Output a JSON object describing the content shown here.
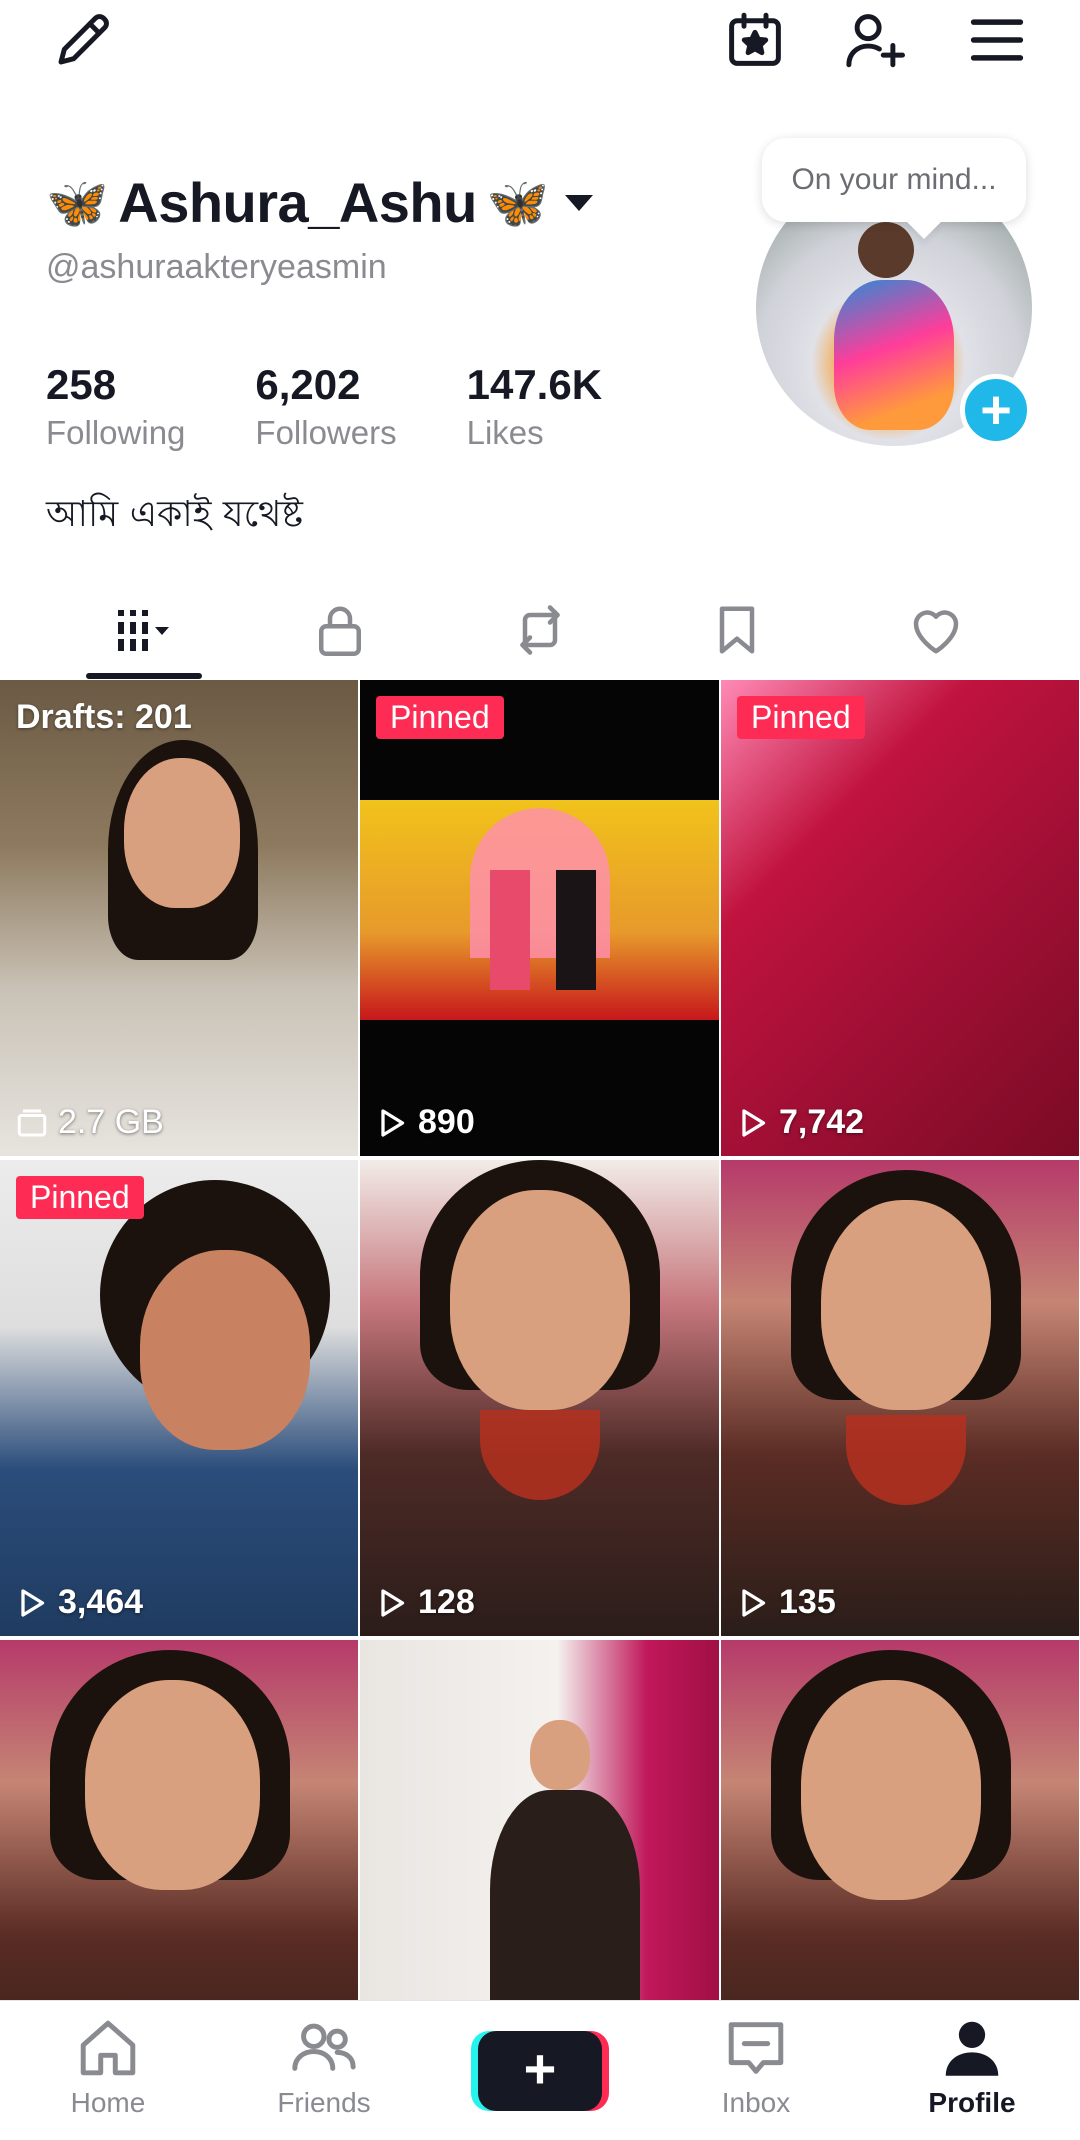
{
  "top_bar": {
    "icons": [
      "pencil-icon",
      "calendar-star-icon",
      "add-friend-icon",
      "menu-icon"
    ]
  },
  "profile": {
    "display_name": "Ashura_Ashu",
    "emoji": "🦋",
    "handle": "@ashuraakteryeasmin",
    "bubble_text": "On your mind...",
    "stats": {
      "following": "258",
      "following_label": "Following",
      "followers": "6,202",
      "followers_label": "Followers",
      "likes": "147.6K",
      "likes_label": "Likes"
    },
    "bio": "আমি একাই যথেষ্ট"
  },
  "tabs": [
    "videos-grid-icon",
    "lock-icon",
    "repost-icon",
    "bookmark-icon",
    "heart-icon"
  ],
  "grid": {
    "drafts_label": "Drafts: 201",
    "drafts_size": "2.7 GB",
    "pinned_label": "Pinned",
    "views": [
      "890",
      "7,742",
      "3,464",
      "128",
      "135"
    ]
  },
  "nav": {
    "home": "Home",
    "friends": "Friends",
    "create": "+",
    "inbox": "Inbox",
    "profile": "Profile"
  },
  "colors": {
    "accent_pink": "#fe2c55",
    "accent_cyan": "#25f4ee",
    "avatar_plus": "#1fb8e8",
    "text_primary": "#161823",
    "text_secondary": "#8a8b91"
  }
}
